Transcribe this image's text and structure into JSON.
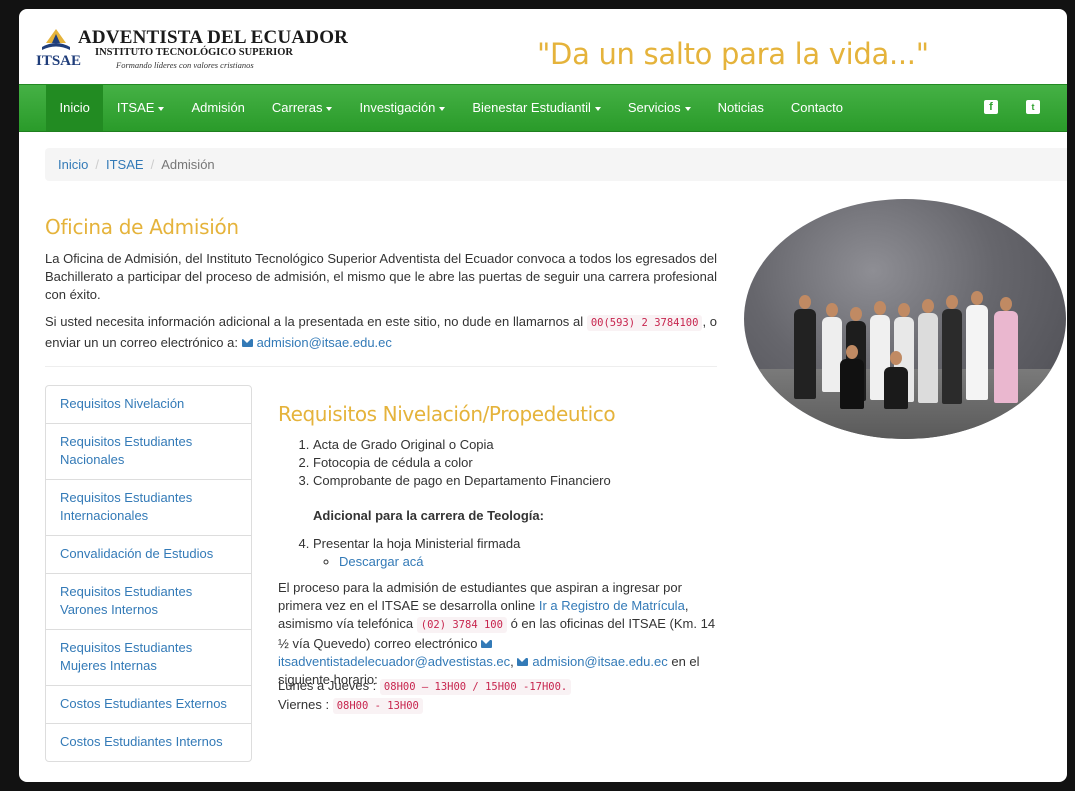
{
  "header": {
    "logo_title": "ADVENTISTA DEL ECUADOR",
    "logo_subtitle": "INSTITUTO TECNOLÓGICO SUPERIOR",
    "logo_tagline": "Formando líderes con valores cristianos",
    "logo_abbr": "ITSAE",
    "slogan": "\"Da un salto para la vida...\""
  },
  "nav": {
    "items": [
      {
        "label": "Inicio",
        "active": true,
        "dropdown": false
      },
      {
        "label": "ITSAE",
        "dropdown": true
      },
      {
        "label": "Admisión",
        "dropdown": false
      },
      {
        "label": "Carreras",
        "dropdown": true
      },
      {
        "label": "Investigación",
        "dropdown": true
      },
      {
        "label": "Bienestar Estudiantil",
        "dropdown": true
      },
      {
        "label": "Servicios",
        "dropdown": true
      },
      {
        "label": "Noticias",
        "dropdown": false
      },
      {
        "label": "Contacto",
        "dropdown": false
      }
    ],
    "social": [
      "facebook-icon",
      "twitter-icon"
    ]
  },
  "breadcrumb": {
    "items": [
      "Inicio",
      "ITSAE"
    ],
    "current": "Admisión"
  },
  "office": {
    "title": "Oficina de Admisión",
    "intro": "La Oficina de Admisión, del Instituto Tecnológico Superior Adventista del Ecuador convoca a todos los egresados del Bachillerato a participar del proceso de admisión, el mismo que le abre las puertas de seguir una carrera profesional con éxito.",
    "info_before_phone": "Si usted necesita información adicional a la presentada en este sitio, no dude en llamarnos al",
    "phone": "00(593) 2 3784100",
    "info_after_phone": ", o enviar un un correo electrónico a:",
    "email": "admision@itsae.edu.ec"
  },
  "sidebar": {
    "items": [
      "Requisitos Nivelación",
      "Requisitos Estudiantes Nacionales",
      "Requisitos Estudiantes Internacionales",
      "Convalidación de Estudios",
      "Requisitos Estudiantes Varones Internos",
      "Requisitos Estudiantes Mujeres Internas",
      "Costos Estudiantes Externos",
      "Costos Estudiantes Internos"
    ]
  },
  "requirements": {
    "title": "Requisitos Nivelación/Propedeutico",
    "list": [
      "Acta de Grado Original o Copia",
      "Fotocopia de cédula a color",
      "Comprobante de pago en Departamento Financiero"
    ],
    "theology_title": "Adicional para la carrera de Teología:",
    "theology_item": "Presentar la hoja Ministerial firmada",
    "download_link": "Descargar acá",
    "process_text1": "El proceso para la admisión de estudiantes que aspiran a ingresar por primera vez en el ITSAE se desarrolla online",
    "process_link": "Ir a Registro de Matrícula",
    "process_text2": ", asimismo vía telefónica",
    "process_phone": "(02) 3784 100",
    "process_text3": "ó en las oficinas del ITSAE (Km. 14 ½ vía Quevedo) correo electrónico",
    "process_email1": "itsadventistadelecuador@advestistas.ec",
    "process_email2": "admision@itsae.edu.ec",
    "process_text4": "en el siguiente horario:",
    "schedule": [
      {
        "days": "Lunes a Jueves :",
        "hours": "08H00 – 13H00 / 15H00 -17H00."
      },
      {
        "days": "Viernes :",
        "hours": "08H00 - 13H00"
      }
    ]
  },
  "colors": {
    "brand_green": "#2fa12f",
    "accent_gold": "#e5b33b",
    "link_blue": "#337ab7",
    "code_red": "#c7254e"
  }
}
